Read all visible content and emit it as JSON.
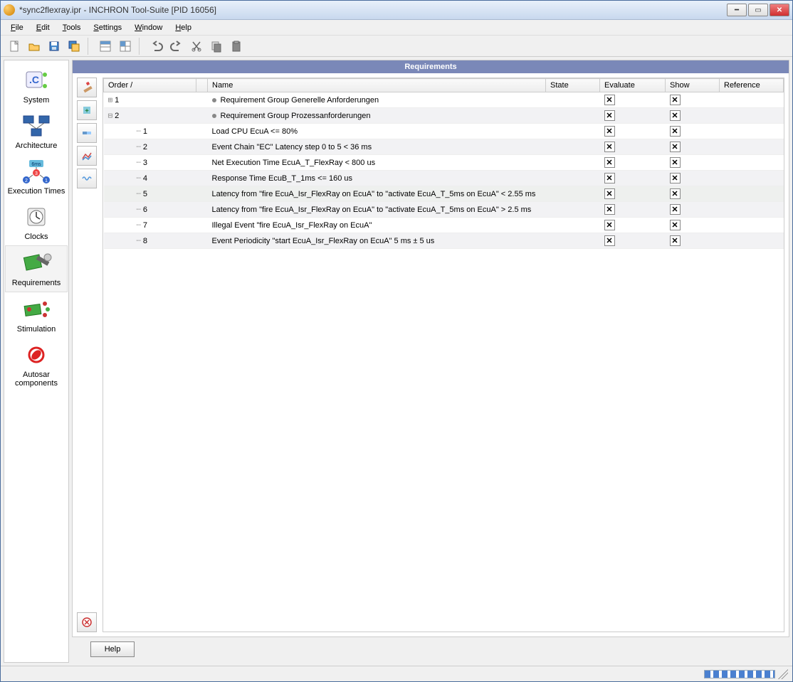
{
  "window": {
    "title": "*sync2flexray.ipr - INCHRON Tool-Suite [PID 16056]"
  },
  "menu": [
    "File",
    "Edit",
    "Tools",
    "Settings",
    "Window",
    "Help"
  ],
  "toolbar_icons": [
    "new",
    "open",
    "save",
    "saveall",
    "|",
    "grid1",
    "grid2",
    "|",
    "undo",
    "redo",
    "cut",
    "copy",
    "paste"
  ],
  "sidebar": {
    "items": [
      {
        "label": "System"
      },
      {
        "label": "Architecture"
      },
      {
        "label": "Execution Times"
      },
      {
        "label": "Clocks"
      },
      {
        "label": "Requirements",
        "selected": true
      },
      {
        "label": "Stimulation"
      },
      {
        "label": "Autosar components"
      }
    ]
  },
  "panel": {
    "title": "Requirements",
    "columns": [
      "Order",
      "",
      "Name",
      "State",
      "Evaluate",
      "Show",
      "Reference"
    ],
    "rows": [
      {
        "depth": 0,
        "expander": "⊞",
        "order": "1",
        "bullet": true,
        "name": "Requirement Group Generelle Anforderungen",
        "evaluate": true,
        "show": true,
        "alt": false
      },
      {
        "depth": 0,
        "expander": "⊟",
        "order": "2",
        "bullet": true,
        "name": "Requirement Group Prozessanforderungen",
        "evaluate": true,
        "show": true,
        "alt": true
      },
      {
        "depth": 1,
        "expander": "",
        "order": "1",
        "bullet": false,
        "name": "Load CPU EcuA <= 80%",
        "evaluate": true,
        "show": true,
        "alt": false
      },
      {
        "depth": 1,
        "expander": "",
        "order": "2",
        "bullet": false,
        "name": "Event Chain \"EC\" Latency step 0 to 5 < 36 ms",
        "evaluate": true,
        "show": true,
        "alt": true
      },
      {
        "depth": 1,
        "expander": "",
        "order": "3",
        "bullet": false,
        "name": "Net Execution Time EcuA_T_FlexRay < 800 us",
        "evaluate": true,
        "show": true,
        "alt": false
      },
      {
        "depth": 1,
        "expander": "",
        "order": "4",
        "bullet": false,
        "name": "Response Time EcuB_T_1ms <= 160 us",
        "evaluate": true,
        "show": true,
        "alt": true
      },
      {
        "depth": 1,
        "expander": "",
        "order": "5",
        "bullet": false,
        "name": "Latency from \"fire EcuA_Isr_FlexRay on EcuA\" to \"activate EcuA_T_5ms on EcuA\" < 2.55 ms",
        "evaluate": true,
        "show": true,
        "alt": false,
        "sel": true
      },
      {
        "depth": 1,
        "expander": "",
        "order": "6",
        "bullet": false,
        "name": "Latency from \"fire EcuA_Isr_FlexRay on EcuA\" to \"activate EcuA_T_5ms on EcuA\" > 2.5 ms",
        "evaluate": true,
        "show": true,
        "alt": true
      },
      {
        "depth": 1,
        "expander": "",
        "order": "7",
        "bullet": false,
        "name": "Illegal Event \"fire EcuA_Isr_FlexRay on EcuA\"",
        "evaluate": true,
        "show": true,
        "alt": false
      },
      {
        "depth": 1,
        "expander": "",
        "order": "8",
        "bullet": false,
        "name": "Event Periodicity \"start EcuA_Isr_FlexRay on EcuA\" 5 ms ± 5 us",
        "evaluate": true,
        "show": true,
        "alt": true
      }
    ]
  },
  "help_label": "Help"
}
